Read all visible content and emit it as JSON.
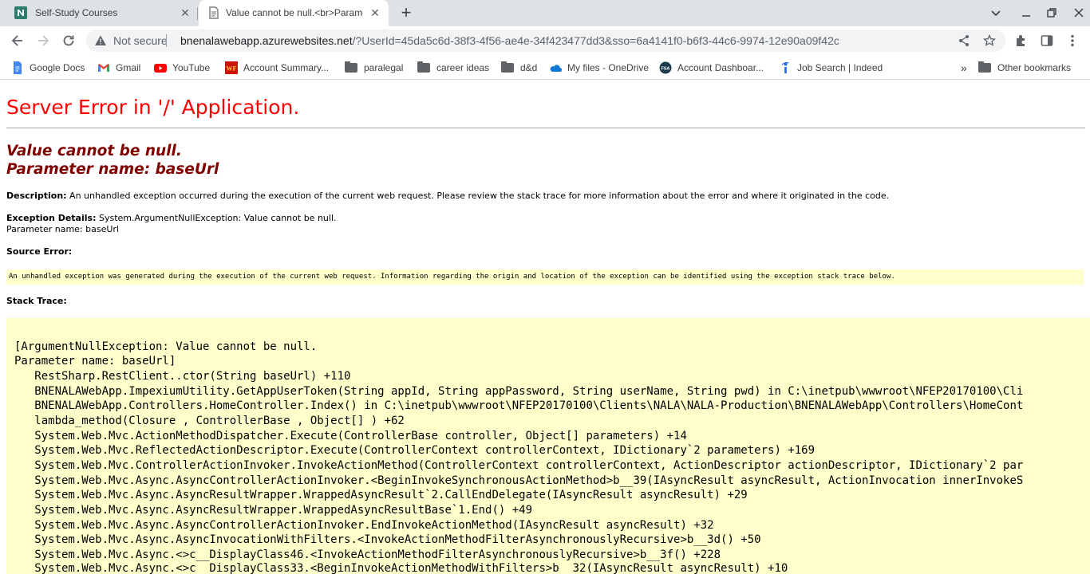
{
  "browser": {
    "tabs": [
      {
        "title": "Self-Study Courses",
        "active": false,
        "favicon": "nala-n-icon"
      },
      {
        "title": "Value cannot be null.<br>Parameter name: baseUrl",
        "active": true,
        "favicon": "document-icon"
      }
    ],
    "address": {
      "security_label": "Not secure",
      "host": "bnenalawebapp.azurewebsites.net",
      "path": "/?UserId=45da5c6d-38f3-4f56-ae4e-34f423477dd3&sso=6a4141f0-b6f3-44c6-9974-12e90a09f42c"
    },
    "bookmarks": [
      {
        "label": "Google Docs",
        "icon": "google-docs-icon"
      },
      {
        "label": "Gmail",
        "icon": "gmail-icon"
      },
      {
        "label": "YouTube",
        "icon": "youtube-icon"
      },
      {
        "label": "Account Summary...",
        "icon": "wf-icon"
      },
      {
        "label": "paralegal",
        "icon": "folder-icon"
      },
      {
        "label": "career ideas",
        "icon": "folder-icon"
      },
      {
        "label": "d&d",
        "icon": "folder-icon"
      },
      {
        "label": "My files - OneDrive",
        "icon": "onedrive-icon"
      },
      {
        "label": "Account Dashboar...",
        "icon": "fsa-icon"
      },
      {
        "label": "Job Search | Indeed",
        "icon": "indeed-icon"
      }
    ],
    "bookmarks_overflow": "»",
    "other_bookmarks": "Other bookmarks"
  },
  "page": {
    "title": "Server Error in '/' Application.",
    "error_message_line1": "Value cannot be null.",
    "error_message_line2": "Parameter name: baseUrl",
    "description_label": "Description:",
    "description_text": " An unhandled exception occurred during the execution of the current web request. Please review the stack trace for more information about the error and where it originated in the code.",
    "exception_label": "Exception Details:",
    "exception_text": " System.ArgumentNullException: Value cannot be null.",
    "exception_param": "Parameter name: baseUrl",
    "source_error_label": "Source Error:",
    "source_error_text": "An unhandled exception was generated during the execution of the current web request. Information regarding the origin and location of the exception can be identified using the exception stack trace below.",
    "stack_trace_label": "Stack Trace:",
    "stack_trace_lines": [
      "[ArgumentNullException: Value cannot be null.",
      "Parameter name: baseUrl]",
      "   RestSharp.RestClient..ctor(String baseUrl) +110",
      "   BNENALAWebApp.ImpexiumUtility.GetAppUserToken(String appId, String appPassword, String userName, String pwd) in C:\\inetpub\\wwwroot\\NFEP20170100\\Cli",
      "   BNENALAWebApp.Controllers.HomeController.Index() in C:\\inetpub\\wwwroot\\NFEP20170100\\Clients\\NALA\\NALA-Production\\BNENALAWebApp\\Controllers\\HomeCont",
      "   lambda_method(Closure , ControllerBase , Object[] ) +62",
      "   System.Web.Mvc.ActionMethodDispatcher.Execute(ControllerBase controller, Object[] parameters) +14",
      "   System.Web.Mvc.ReflectedActionDescriptor.Execute(ControllerContext controllerContext, IDictionary`2 parameters) +169",
      "   System.Web.Mvc.ControllerActionInvoker.InvokeActionMethod(ControllerContext controllerContext, ActionDescriptor actionDescriptor, IDictionary`2 par",
      "   System.Web.Mvc.Async.AsyncControllerActionInvoker.<BeginInvokeSynchronousActionMethod>b__39(IAsyncResult asyncResult, ActionInvocation innerInvokeS",
      "   System.Web.Mvc.Async.AsyncResultWrapper.WrappedAsyncResult`2.CallEndDelegate(IAsyncResult asyncResult) +29",
      "   System.Web.Mvc.Async.AsyncResultWrapper.WrappedAsyncResultBase`1.End() +49",
      "   System.Web.Mvc.Async.AsyncControllerActionInvoker.EndInvokeActionMethod(IAsyncResult asyncResult) +32",
      "   System.Web.Mvc.Async.AsyncInvocationWithFilters.<InvokeActionMethodFilterAsynchronouslyRecursive>b__3d() +50",
      "   System.Web.Mvc.Async.<>c__DisplayClass46.<InvokeActionMethodFilterAsynchronouslyRecursive>b__3f() +228",
      "   System.Web.Mvc.Async.<>c__DisplayClass33.<BeginInvokeActionMethodWithFilters>b__32(IAsyncResult asyncResult) +10"
    ]
  },
  "colors": {
    "title_red": "#ff0000",
    "message_maroon": "#800000",
    "code_background": "#ffffcc"
  }
}
